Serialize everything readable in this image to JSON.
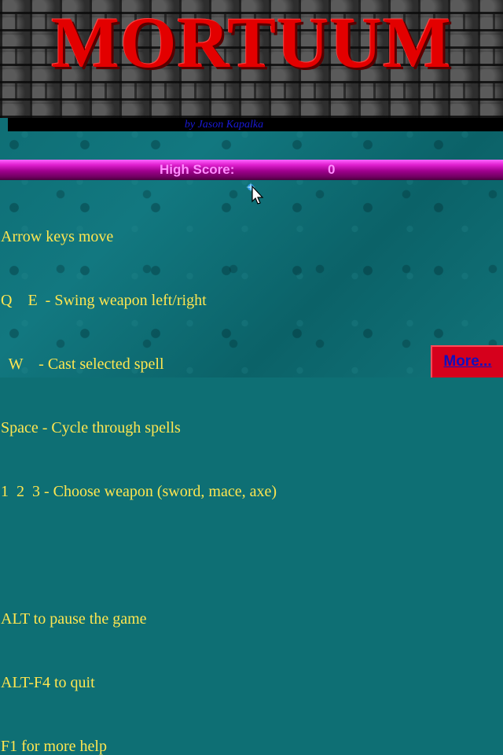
{
  "game": {
    "title": "MORTUUM",
    "byline": "by Jason Kapalka"
  },
  "high_score": {
    "label": "High Score:",
    "value": "0"
  },
  "help_lines": [
    "Arrow keys move",
    "Q    E  - Swing weapon left/right",
    "  W    - Cast selected spell",
    "Space - Cycle through spells",
    "1  2  3 - Choose weapon (sword, mace, axe)",
    "ALT to pause the game",
    "ALT-F4 to quit",
    "F1 for more help"
  ],
  "more_button": {
    "label": "More..."
  },
  "colors": {
    "title": "#e30000",
    "byline": "#1a1ad8",
    "help_text": "#ffe650",
    "score_bar": "#c010b0",
    "more_button_bg": "#d6001c",
    "more_button_text": "#1010c0",
    "background": "#0e6f74"
  },
  "icons": {
    "cursor": "arrow-cursor-icon",
    "sparkle": "sparkle-icon"
  }
}
